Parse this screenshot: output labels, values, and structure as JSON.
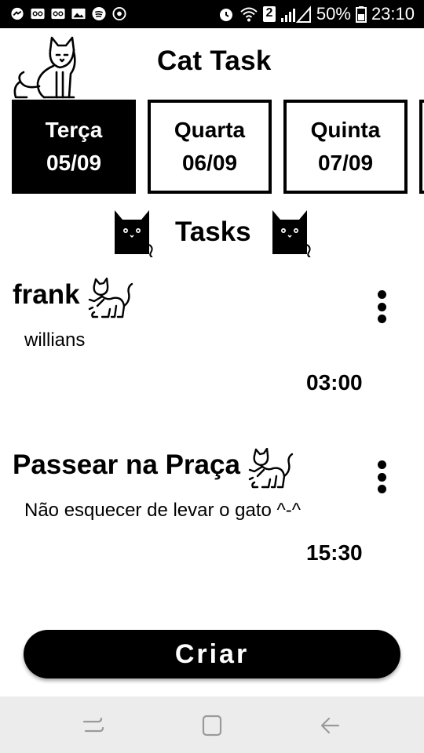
{
  "status_bar": {
    "left_icons": [
      "messenger-icon",
      "voicemail-icon",
      "voicemail-icon",
      "image-icon",
      "spotify-icon",
      "sync-icon"
    ],
    "right_icons": [
      "alarm-icon",
      "wifi-icon",
      "sim-icon",
      "signal-icon"
    ],
    "sim_number": "2",
    "battery": "50%",
    "time": "23:10"
  },
  "header": {
    "title": "Cat Task"
  },
  "days": [
    {
      "name": "Terça",
      "date": "05/09",
      "selected": true
    },
    {
      "name": "Quarta",
      "date": "06/09",
      "selected": false
    },
    {
      "name": "Quinta",
      "date": "07/09",
      "selected": false
    }
  ],
  "tasks_section": {
    "title": "Tasks"
  },
  "tasks": [
    {
      "title": "frank",
      "description": "willians",
      "time": "03:00"
    },
    {
      "title": "Passear na Praça",
      "description": "Não esquecer de levar o gato ^-^",
      "time": "15:30"
    }
  ],
  "create_button": {
    "label": "Criar"
  },
  "nav_bar": {
    "buttons": [
      "recent-apps-icon",
      "home-icon",
      "back-icon"
    ]
  }
}
